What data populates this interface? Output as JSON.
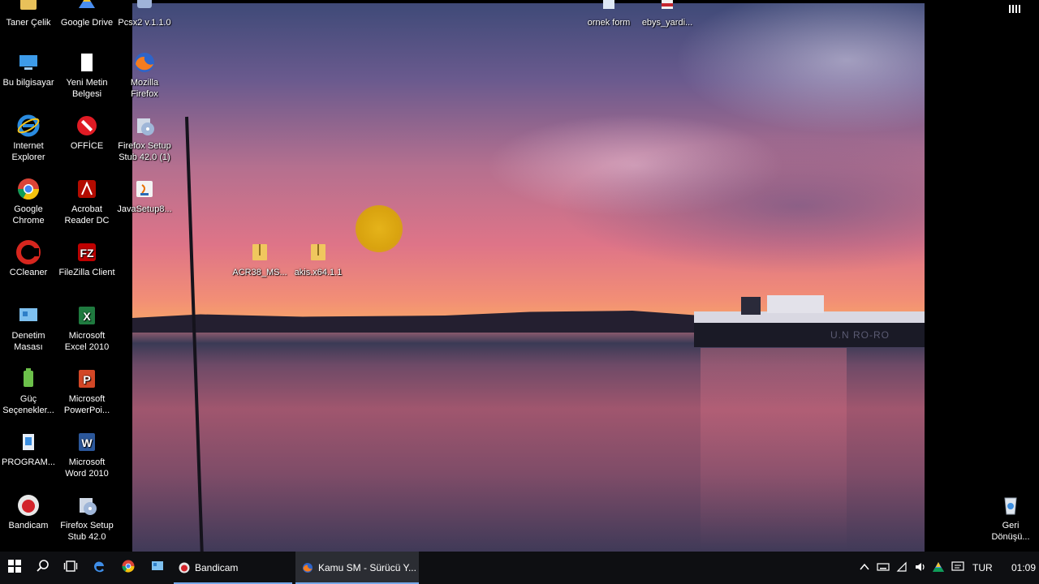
{
  "desktop_icons": {
    "taner_celik": "Taner Çelik",
    "google_drive": "Google Drive",
    "pcsx2": "Pcsx2 v.1.1.0",
    "ornek_form": "ornek form",
    "ebys_yardim": "ebys_yardi...",
    "bu_bilgisayar": "Bu bilgisayar",
    "yeni_metin": "Yeni Metin Belgesi",
    "mozilla": "Mozilla Firefox",
    "internet_explorer": "Internet Explorer",
    "office": "OFFİCE",
    "firefox_setup_1": "Firefox Setup Stub 42.0 (1)",
    "google_chrome": "Google Chrome",
    "acrobat": "Acrobat Reader DC",
    "javasetup": "JavaSetup8...",
    "ccleaner": "CCleaner",
    "filezilla": "FileZilla Client",
    "acr38": "ACR38_MS...",
    "akis": "akis.x64.1.1",
    "denetim": "Denetim Masası",
    "excel": "Microsoft Excel 2010",
    "guc": "Güç Seçenekler...",
    "powerpoint": "Microsoft PowerPoi...",
    "program": "PROGRAM...",
    "word": "Microsoft Word 2010",
    "bandicam": "Bandicam",
    "firefox_setup": "Firefox Setup Stub 42.0",
    "geri_donusum": "Geri Dönüşü..."
  },
  "wallpaper": {
    "ship_label": "U.N RO-RO"
  },
  "taskbar": {
    "tasks": [
      {
        "label": "Bandicam"
      },
      {
        "label": "Kamu SM - Sürücü Y..."
      }
    ],
    "language": "TUR",
    "clock": "01:09"
  },
  "colors": {
    "taskbar": "#0e0f12",
    "active_indicator": "#76a8e8",
    "cursor_highlight": "#e5b31a"
  }
}
